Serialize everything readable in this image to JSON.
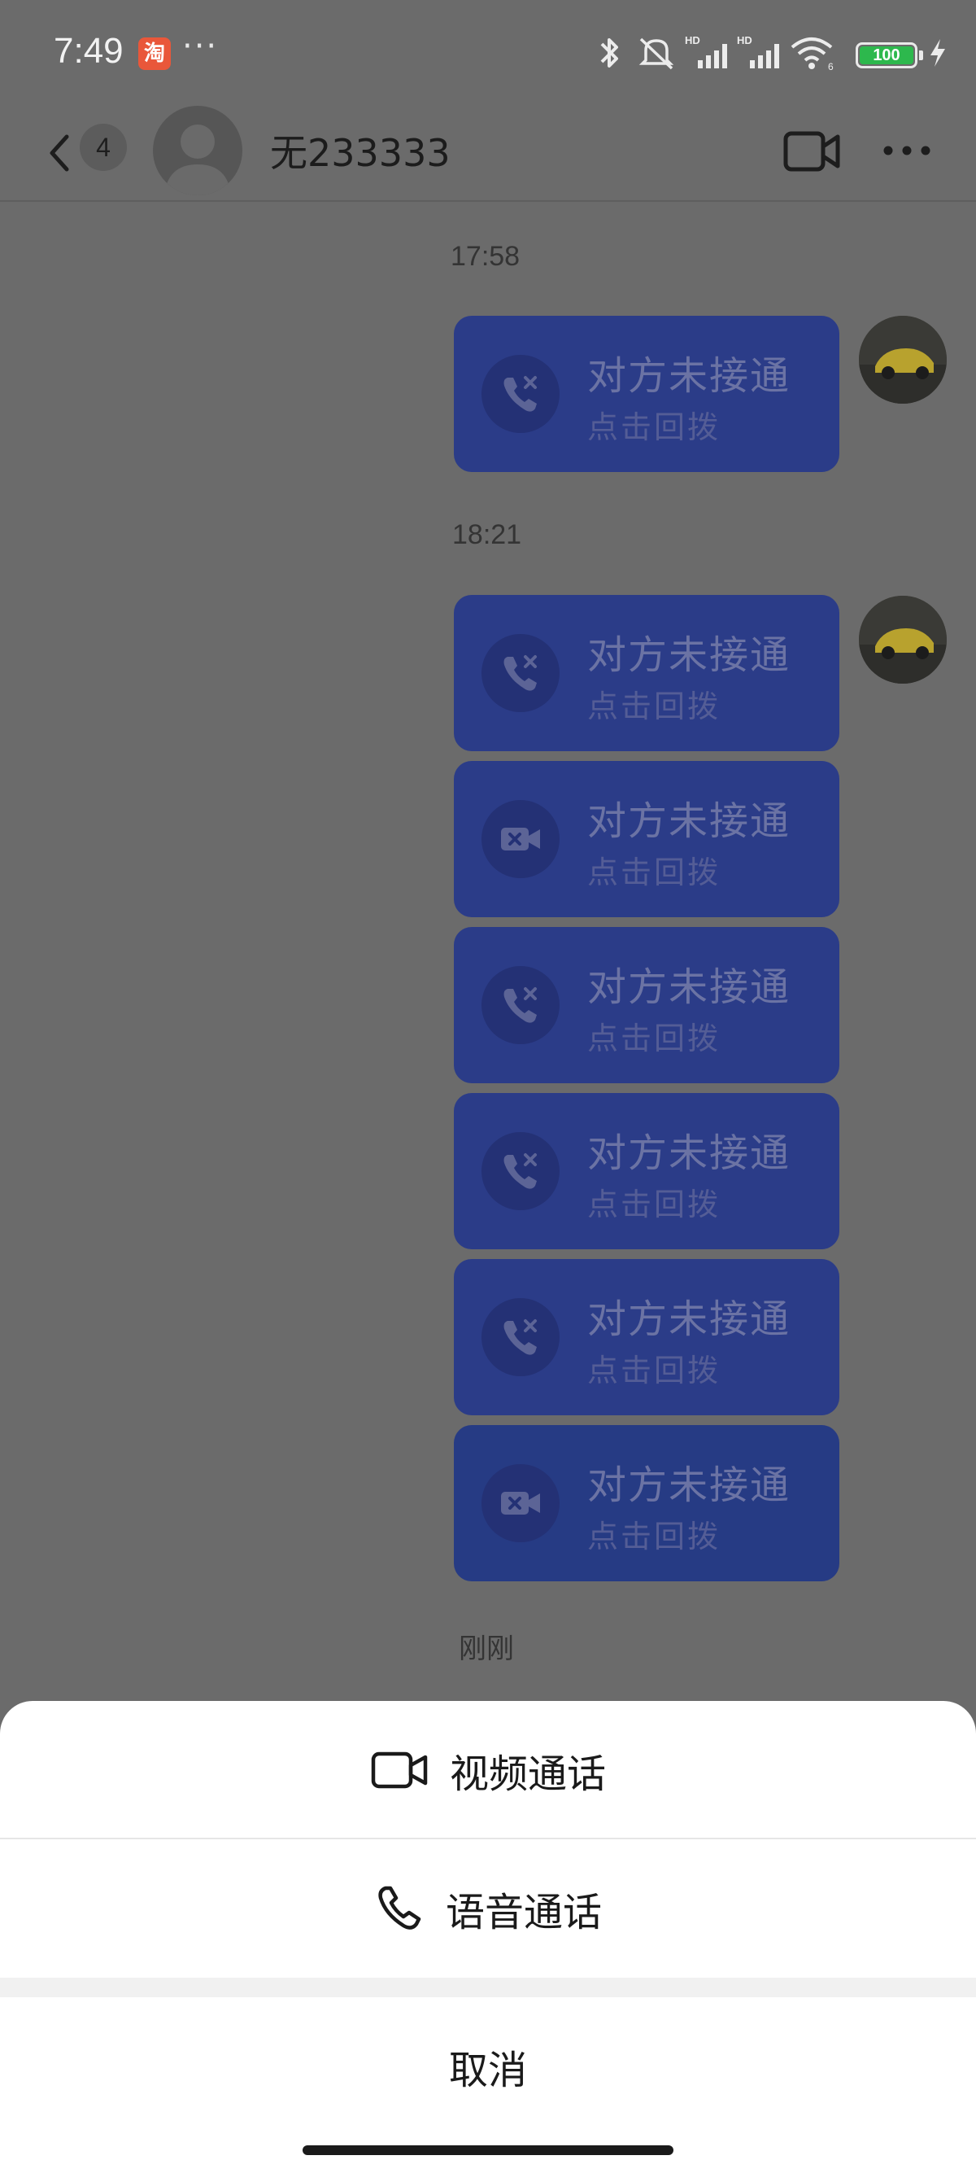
{
  "status_bar": {
    "time": "7:49",
    "app_icon_char": "淘",
    "more": "···",
    "battery": "100",
    "icons": [
      "bluetooth-icon",
      "mute-icon",
      "hd-signal-icon",
      "hd-signal-icon",
      "wifi-icon",
      "battery-icon",
      "charging-icon"
    ]
  },
  "header": {
    "unread_count": "4",
    "contact_name": "无233333",
    "icons": [
      "back-arrow-icon",
      "default-avatar-icon",
      "video-camera-icon",
      "more-dots-icon"
    ]
  },
  "messages": [
    {
      "time": "17:58"
    },
    {
      "type": "voice",
      "title": "对方未接通",
      "subtitle": "点击回拨"
    },
    {
      "time": "18:21"
    },
    {
      "type": "voice",
      "title": "对方未接通",
      "subtitle": "点击回拨"
    },
    {
      "type": "video",
      "title": "对方未接通",
      "subtitle": "点击回拨"
    },
    {
      "type": "voice",
      "title": "对方未接通",
      "subtitle": "点击回拨"
    },
    {
      "type": "voice",
      "title": "对方未接通",
      "subtitle": "点击回拨"
    },
    {
      "type": "voice",
      "title": "对方未接通",
      "subtitle": "点击回拨"
    },
    {
      "type": "video",
      "title": "对方未接通",
      "subtitle": "点击回拨"
    },
    {
      "time": "刚刚"
    }
  ],
  "action_sheet": {
    "video_call": "视频通话",
    "voice_call": "语音通话",
    "cancel": "取消"
  },
  "colors": {
    "overlay_bg": "#6b6b6b",
    "bubble": "#2b3c88",
    "sheet": "#ffffff"
  }
}
